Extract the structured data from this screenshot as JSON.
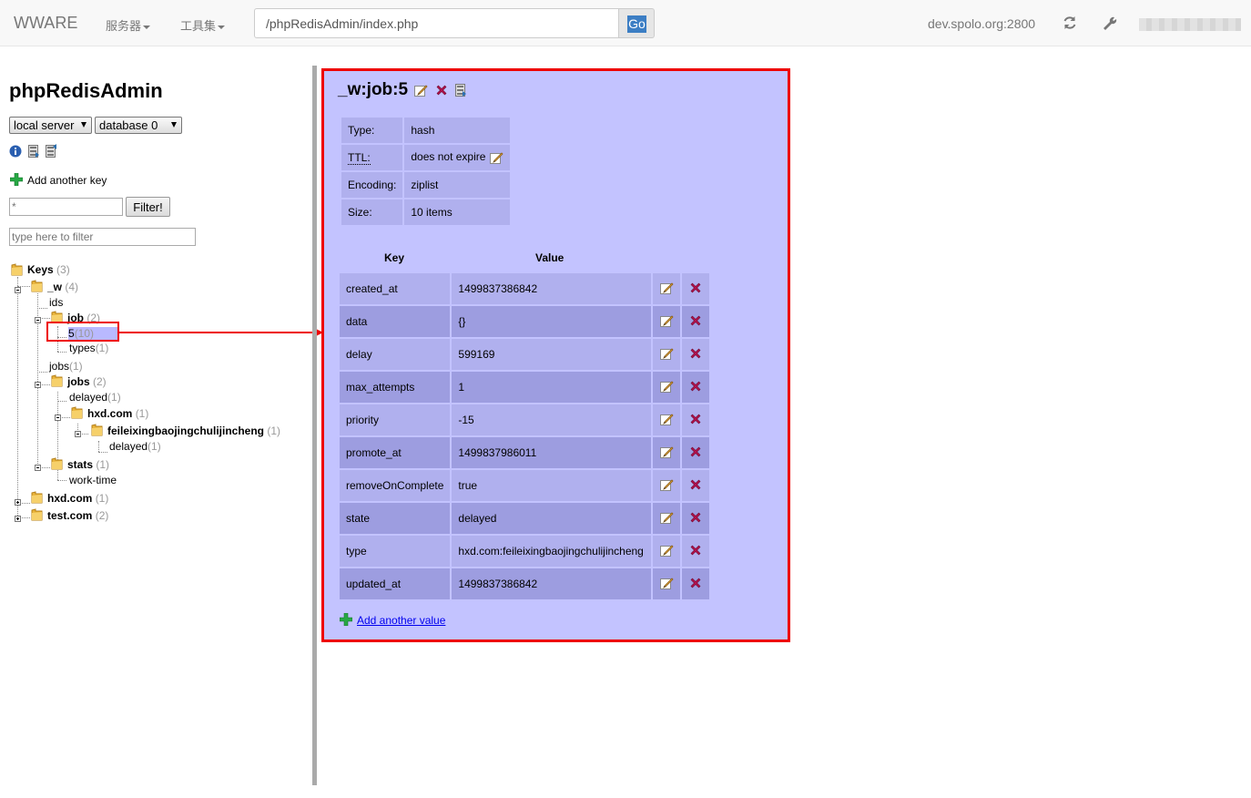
{
  "navbar": {
    "brand": "WWARE",
    "menu_servers": "服务器",
    "menu_tools": "工具集",
    "url": "/phpRedisAdmin/index.php",
    "go_label": "Go",
    "host": "dev.spolo.org:2800",
    "refresh_icon": "refresh-icon",
    "wrench_icon": "wrench-icon"
  },
  "sidebar": {
    "title": "phpRedisAdmin",
    "server_select": "local server",
    "database_select": "database 0",
    "add_key_label": "Add another key",
    "filter_placeholder": "*",
    "filter_button": "Filter!",
    "type_filter_placeholder": "type here to filter",
    "tree": {
      "keys": {
        "label": "Keys",
        "count": "(3)"
      },
      "w": {
        "label": "_w",
        "count": "(4)"
      },
      "ids": {
        "label": "ids"
      },
      "job": {
        "label": "job",
        "count": "(2)"
      },
      "job5": {
        "label": "5",
        "count": "(10)"
      },
      "types": {
        "label": "types",
        "count": "(1)"
      },
      "jobs_leaf": {
        "label": "jobs",
        "count": "(1)"
      },
      "jobs": {
        "label": "jobs",
        "count": "(2)"
      },
      "delayed1": {
        "label": "delayed",
        "count": "(1)"
      },
      "hxd_inner": {
        "label": "hxd.com",
        "count": "(1)"
      },
      "feilei": {
        "label": "feileixingbaojingchulijincheng",
        "count": "(1)"
      },
      "delayed2": {
        "label": "delayed",
        "count": "(1)"
      },
      "stats": {
        "label": "stats",
        "count": "(1)"
      },
      "worktime": {
        "label": "work-time"
      },
      "hxd": {
        "label": "hxd.com",
        "count": "(1)"
      },
      "test": {
        "label": "test.com",
        "count": "(2)"
      }
    }
  },
  "panel": {
    "key_name": "_w:job:5",
    "info": [
      {
        "label": "Type:",
        "value": "hash"
      },
      {
        "label": "TTL:",
        "value": "does not expire"
      },
      {
        "label": "Encoding:",
        "value": "ziplist"
      },
      {
        "label": "Size:",
        "value": "10 items"
      }
    ],
    "col_key": "Key",
    "col_value": "Value",
    "rows": [
      {
        "key": "created_at",
        "value": "1499837386842"
      },
      {
        "key": "data",
        "value": "{}"
      },
      {
        "key": "delay",
        "value": "599169"
      },
      {
        "key": "max_attempts",
        "value": "1"
      },
      {
        "key": "priority",
        "value": "-15"
      },
      {
        "key": "promote_at",
        "value": "1499837986011"
      },
      {
        "key": "removeOnComplete",
        "value": "true"
      },
      {
        "key": "state",
        "value": "delayed"
      },
      {
        "key": "type",
        "value": "hxd.com:feileixingbaojingchulijincheng"
      },
      {
        "key": "updated_at",
        "value": "1499837386842"
      }
    ],
    "add_value_label": "Add another value"
  },
  "colors": {
    "highlight": "#ee0000",
    "panel_bg": "#c3c3ff",
    "row_light": "#b0b0ee",
    "row_dark": "#9d9de0"
  }
}
